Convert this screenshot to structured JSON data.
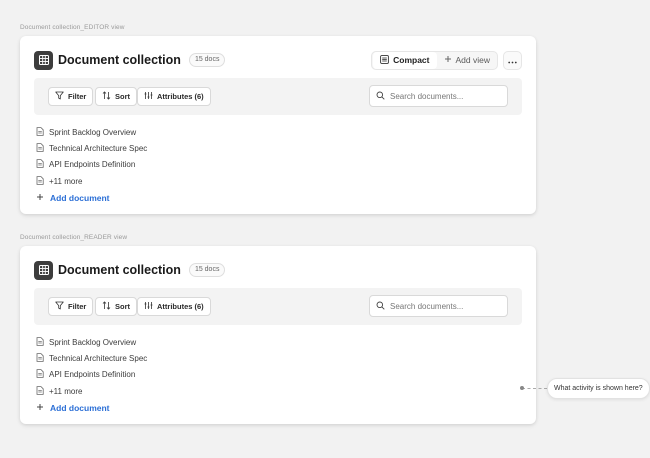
{
  "sections": [
    {
      "label": "Document collection_EDITOR view",
      "title": "Document collection",
      "count": "15 docs",
      "compact_label": "Compact",
      "add_view_label": "Add view",
      "filter_label": "Filter",
      "sort_label": "Sort",
      "attributes_label": "Attributes (6)",
      "search_placeholder": "Search documents...",
      "docs": [
        "Sprint Backlog Overview",
        "Technical Architecture Spec",
        "API Endpoints Definition",
        "+11 more"
      ],
      "add_document_label": "Add document"
    },
    {
      "label": "Document collection_READER view",
      "title": "Document collection",
      "count": "15 docs",
      "filter_label": "Filter",
      "sort_label": "Sort",
      "attributes_label": "Attributes (6)",
      "search_placeholder": "Search documents...",
      "docs": [
        "Sprint Backlog Overview",
        "Technical Architecture Spec",
        "API Endpoints Definition",
        "+11 more"
      ],
      "add_document_label": "Add document"
    }
  ],
  "tooltip": "What activity is shown here?",
  "colors": {
    "accent": "#2b6fd6",
    "icon_bg": "#3d3d3d",
    "toolbar_bg": "#f3f3f3",
    "page_bg": "#f2f2f2"
  },
  "icons": [
    "table-grid-icon",
    "compact-view-icon",
    "plus-icon",
    "more-dots-icon",
    "filter-icon",
    "sort-icon",
    "attributes-icon",
    "search-icon",
    "document-icon"
  ]
}
